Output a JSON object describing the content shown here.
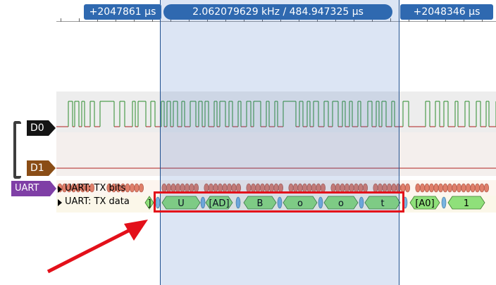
{
  "ruler": {
    "left_cursor": "+2047861 µs",
    "center_measure": "2.062079629 kHz / 484.947325 µs",
    "right_cursor": "+2048346 µs"
  },
  "channels": {
    "d0": "D0",
    "d1": "D1",
    "decoder": "UART"
  },
  "rows": {
    "tx_bits": "UART: TX bits",
    "tx_data": "UART: TX data"
  },
  "decoded_data": [
    "]",
    "U",
    "[AD]",
    "B",
    "o",
    "o",
    "t",
    "[A0]",
    "1"
  ],
  "colors": {
    "selection": "#2d64be",
    "cursor_pill": "#2f69b0",
    "d0_label": "#141414",
    "d1_label": "#8a4d16",
    "uart_label": "#7f3fa6",
    "trace_high": "#2c8c2c",
    "trace_low": "#b02020",
    "bit_fill": "#e07f6a",
    "data_fill": "#8fe07a",
    "highlight": "#e3101a"
  }
}
